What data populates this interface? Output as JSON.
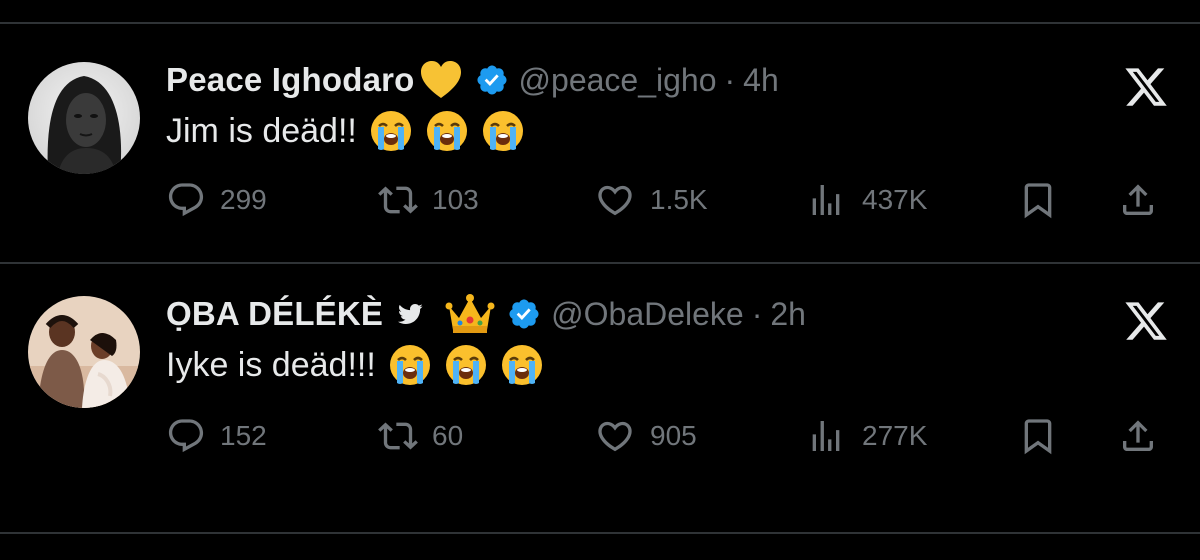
{
  "colors": {
    "background": "#000000",
    "text": "#e7e9ea",
    "muted": "#71767b",
    "verified": "#1d9bf0",
    "divider": "#2f3336"
  },
  "tweets": [
    {
      "name": "Peace Ighodaro",
      "name_emojis": [
        "yellow-heart"
      ],
      "verified": true,
      "handle": "@peace_igho",
      "separator": "·",
      "time": "4h",
      "text": "Jim is deäd!!",
      "text_emojis": [
        "loudly-crying-face",
        "loudly-crying-face",
        "loudly-crying-face"
      ],
      "replies": "299",
      "retweets": "103",
      "likes": "1.5K",
      "views": "437K"
    },
    {
      "name": "ỌBA DÉLÉKÈ",
      "name_emojis": [
        "bird",
        "crown"
      ],
      "verified": true,
      "handle": "@ObaDeleke",
      "separator": "·",
      "time": "2h",
      "text": "Iyke is deäd!!!",
      "text_emojis": [
        "loudly-crying-face",
        "loudly-crying-face",
        "loudly-crying-face"
      ],
      "replies": "152",
      "retweets": "60",
      "likes": "905",
      "views": "277K"
    }
  ]
}
